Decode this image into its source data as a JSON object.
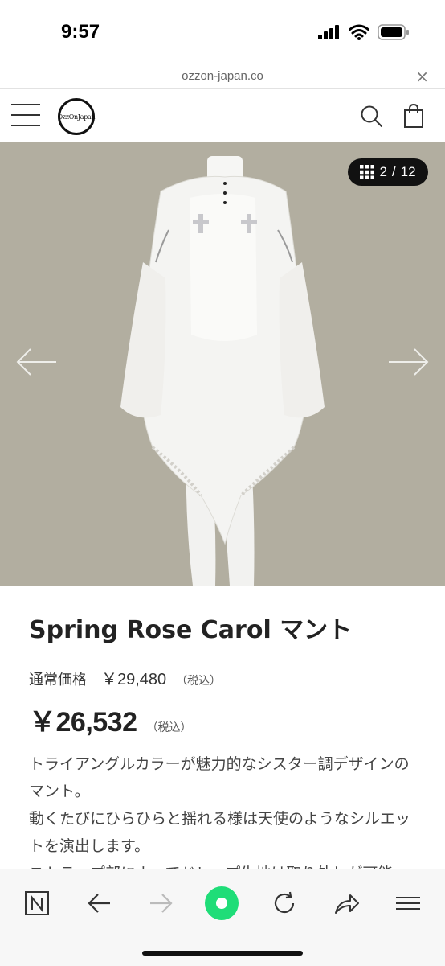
{
  "status_bar": {
    "time": "9:57"
  },
  "browser": {
    "url": "ozzon-japan.co",
    "close_label": "×"
  },
  "header": {
    "logo_text": "OzzOnJapan"
  },
  "gallery": {
    "current": "2",
    "separator": "/",
    "total": "12",
    "bg_color": "#b2aea0"
  },
  "product": {
    "title": "Spring Rose Carol マント",
    "regular_label": "通常価格",
    "regular_price": "￥29,480",
    "regular_tax": "（税込）",
    "sale_price": "￥26,532",
    "sale_tax": "（税込）",
    "description_lines": [
      "トライアングルカラーが魅力的なシスター調デザインのマント。",
      "動くたびにひらひらと揺れる様は天使のようなシルエットを演出します。",
      "ストラップ部によってドレープ生地は取り外しが可能"
    ]
  },
  "toolbar": {
    "items": [
      "n-logo-icon",
      "back-icon",
      "forward-icon",
      "home-dot-icon",
      "reload-icon",
      "share-icon",
      "menu-icon"
    ],
    "accent_color": "#1fdd78"
  }
}
